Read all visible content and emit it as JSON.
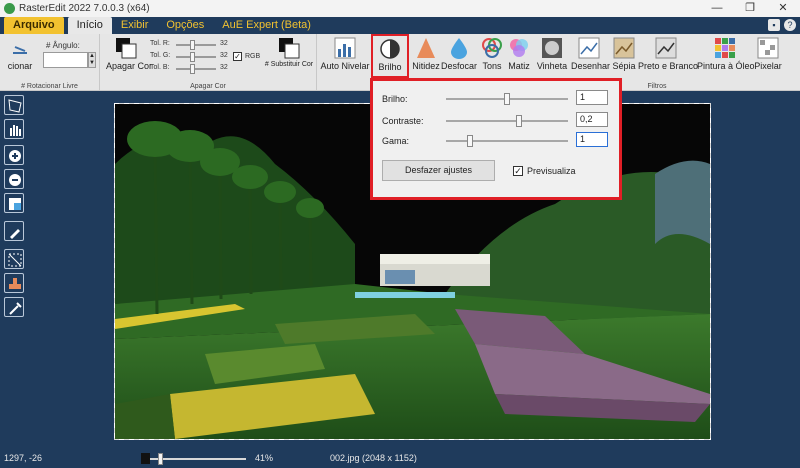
{
  "window": {
    "title": "RasterEdit 2022 7.0.0.3 (x64)",
    "minimize": "—",
    "restore": "❐",
    "close": "✕"
  },
  "menu": {
    "file": "Arquivo",
    "tabs": [
      "Início",
      "Exibir",
      "Opções",
      "AuE Expert (Beta)"
    ]
  },
  "ribbon": {
    "rotate": {
      "partial_label": "cionar",
      "angle_label": "# Ângulo:",
      "group_label": "# Rotacionar Livre"
    },
    "color": {
      "clear_label": "Apagar Cor",
      "tol_r": "Tol. R:",
      "tol_g": "Tol. G:",
      "tol_b": "Tol. B:",
      "tol_r_val": "32",
      "tol_g_val": "32",
      "tol_b_val": "32",
      "rgb_label": "RGB",
      "replace_label": "# Substituir Cor",
      "group_label": "Apagar Cor"
    },
    "tools": [
      "Auto Nivelar",
      "Brilho",
      "Nitidez",
      "Desfocar",
      "Tons",
      "Matiz",
      "Vinheta",
      "Desenhar",
      "Sépia",
      "Preto e Branco",
      "Pintura à Óleo",
      "Pixelar"
    ],
    "filters_label": "Filtros"
  },
  "dialog": {
    "brightness_label": "Brilho:",
    "brightness_value": "1",
    "contrast_label": "Contraste:",
    "contrast_value": "0,2",
    "gamma_label": "Gama:",
    "gamma_value": "1",
    "reset_button": "Desfazer ajustes",
    "preview_label": "Previsualiza",
    "preview_checked": true,
    "brightness_level": 0.5,
    "contrast_level": 0.6,
    "gamma_level": 0.18
  },
  "status": {
    "coords": "1297, -26",
    "zoom": "41%",
    "file": "002.jpg (2048 x 1152)"
  },
  "colors": {
    "accent": "#f2c230",
    "frame": "#1f3b5c",
    "highlight": "#e01f26"
  }
}
